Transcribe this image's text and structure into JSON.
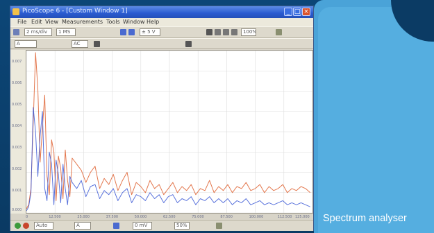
{
  "caption": "Spectrum analyser",
  "window": {
    "title": "PicoScope 6 - [Custom Window 1]",
    "menu": [
      "File",
      "Edit",
      "View",
      "Measurements",
      "Tools",
      "Window",
      "Help"
    ],
    "toolbar1": {
      "collection_time": "2 ms/div",
      "samples": "1 MS",
      "voltage_range": "± 5 V",
      "zoom": "100%"
    },
    "toolbar2": {
      "channel": "A",
      "coupling": "AC"
    },
    "status": {
      "trigger_mode": "Auto",
      "trigger_channel": "A",
      "threshold": "0 mV",
      "pre_trigger": "50%"
    }
  },
  "chart_data": {
    "type": "line",
    "y_ticks": [
      "0.000",
      "0.001",
      "0.002",
      "0.003",
      "0.004",
      "0.005",
      "0.006",
      "0.007"
    ],
    "x_ticks": [
      "0",
      "12.500",
      "25.000",
      "37.500",
      "50.000",
      "62.500",
      "75.000",
      "87.500",
      "100.000",
      "112.500",
      "125.000"
    ],
    "ylim": [
      0,
      0.008
    ],
    "xlim": [
      0,
      125
    ],
    "grid": true,
    "series": [
      {
        "color": "#e0683a",
        "x": [
          0,
          1,
          2,
          3,
          4,
          5,
          6,
          7,
          8,
          9,
          10,
          11,
          12,
          13,
          14,
          15,
          16,
          17,
          18,
          19,
          20,
          22,
          24,
          26,
          28,
          30,
          32,
          34,
          36,
          38,
          40,
          42,
          44,
          46,
          48,
          50,
          52,
          54,
          56,
          58,
          60,
          62,
          64,
          66,
          68,
          70,
          72,
          74,
          76,
          78,
          80,
          82,
          84,
          86,
          88,
          90,
          92,
          94,
          96,
          98,
          100,
          102,
          104,
          106,
          108,
          110,
          112,
          114,
          116,
          118,
          120,
          122,
          124
        ],
        "values": [
          0.0002,
          0.0004,
          0.0012,
          0.0045,
          0.0079,
          0.0061,
          0.0025,
          0.0042,
          0.0058,
          0.0018,
          0.0009,
          0.0036,
          0.003,
          0.0006,
          0.0028,
          0.0022,
          0.0007,
          0.0031,
          0.0016,
          0.0008,
          0.0027,
          0.0024,
          0.0021,
          0.0015,
          0.002,
          0.0023,
          0.0012,
          0.0017,
          0.0014,
          0.0019,
          0.0011,
          0.0016,
          0.002,
          0.0009,
          0.0015,
          0.0013,
          0.001,
          0.0016,
          0.0012,
          0.0014,
          0.0009,
          0.0012,
          0.0015,
          0.001,
          0.0013,
          0.0011,
          0.0014,
          0.0009,
          0.0012,
          0.0011,
          0.0016,
          0.001,
          0.0013,
          0.0011,
          0.0014,
          0.001,
          0.0013,
          0.0012,
          0.0015,
          0.0011,
          0.0012,
          0.0014,
          0.001,
          0.0013,
          0.0011,
          0.0012,
          0.0014,
          0.001,
          0.0012,
          0.0011,
          0.0013,
          0.0012,
          0.001
        ]
      },
      {
        "color": "#3d5bd6",
        "x": [
          0,
          1,
          2,
          3,
          4,
          5,
          6,
          7,
          8,
          9,
          10,
          11,
          12,
          13,
          14,
          15,
          16,
          17,
          18,
          19,
          20,
          22,
          24,
          26,
          28,
          30,
          32,
          34,
          36,
          38,
          40,
          42,
          44,
          46,
          48,
          50,
          52,
          54,
          56,
          58,
          60,
          62,
          64,
          66,
          68,
          70,
          72,
          74,
          76,
          78,
          80,
          82,
          84,
          86,
          88,
          90,
          92,
          94,
          96,
          98,
          100,
          102,
          104,
          106,
          108,
          110,
          112,
          114,
          116,
          118,
          120,
          122,
          124
        ],
        "values": [
          0.0001,
          0.0003,
          0.001,
          0.0052,
          0.004,
          0.0018,
          0.0038,
          0.005,
          0.0012,
          0.0006,
          0.003,
          0.0024,
          0.0004,
          0.0026,
          0.0019,
          0.0005,
          0.0024,
          0.0012,
          0.0004,
          0.0018,
          0.0015,
          0.0012,
          0.0016,
          0.0008,
          0.0013,
          0.0014,
          0.0007,
          0.0011,
          0.0009,
          0.0012,
          0.0006,
          0.001,
          0.0012,
          0.0005,
          0.0009,
          0.0008,
          0.0006,
          0.001,
          0.0007,
          0.0009,
          0.0005,
          0.0008,
          0.0009,
          0.0005,
          0.0007,
          0.0006,
          0.0008,
          0.0004,
          0.0007,
          0.0006,
          0.0008,
          0.0005,
          0.0007,
          0.0005,
          0.0007,
          0.0004,
          0.0006,
          0.0005,
          0.0007,
          0.0004,
          0.0005,
          0.0006,
          0.0004,
          0.0005,
          0.0004,
          0.0005,
          0.0006,
          0.0004,
          0.0005,
          0.0004,
          0.0005,
          0.0004,
          0.0003
        ]
      }
    ]
  }
}
